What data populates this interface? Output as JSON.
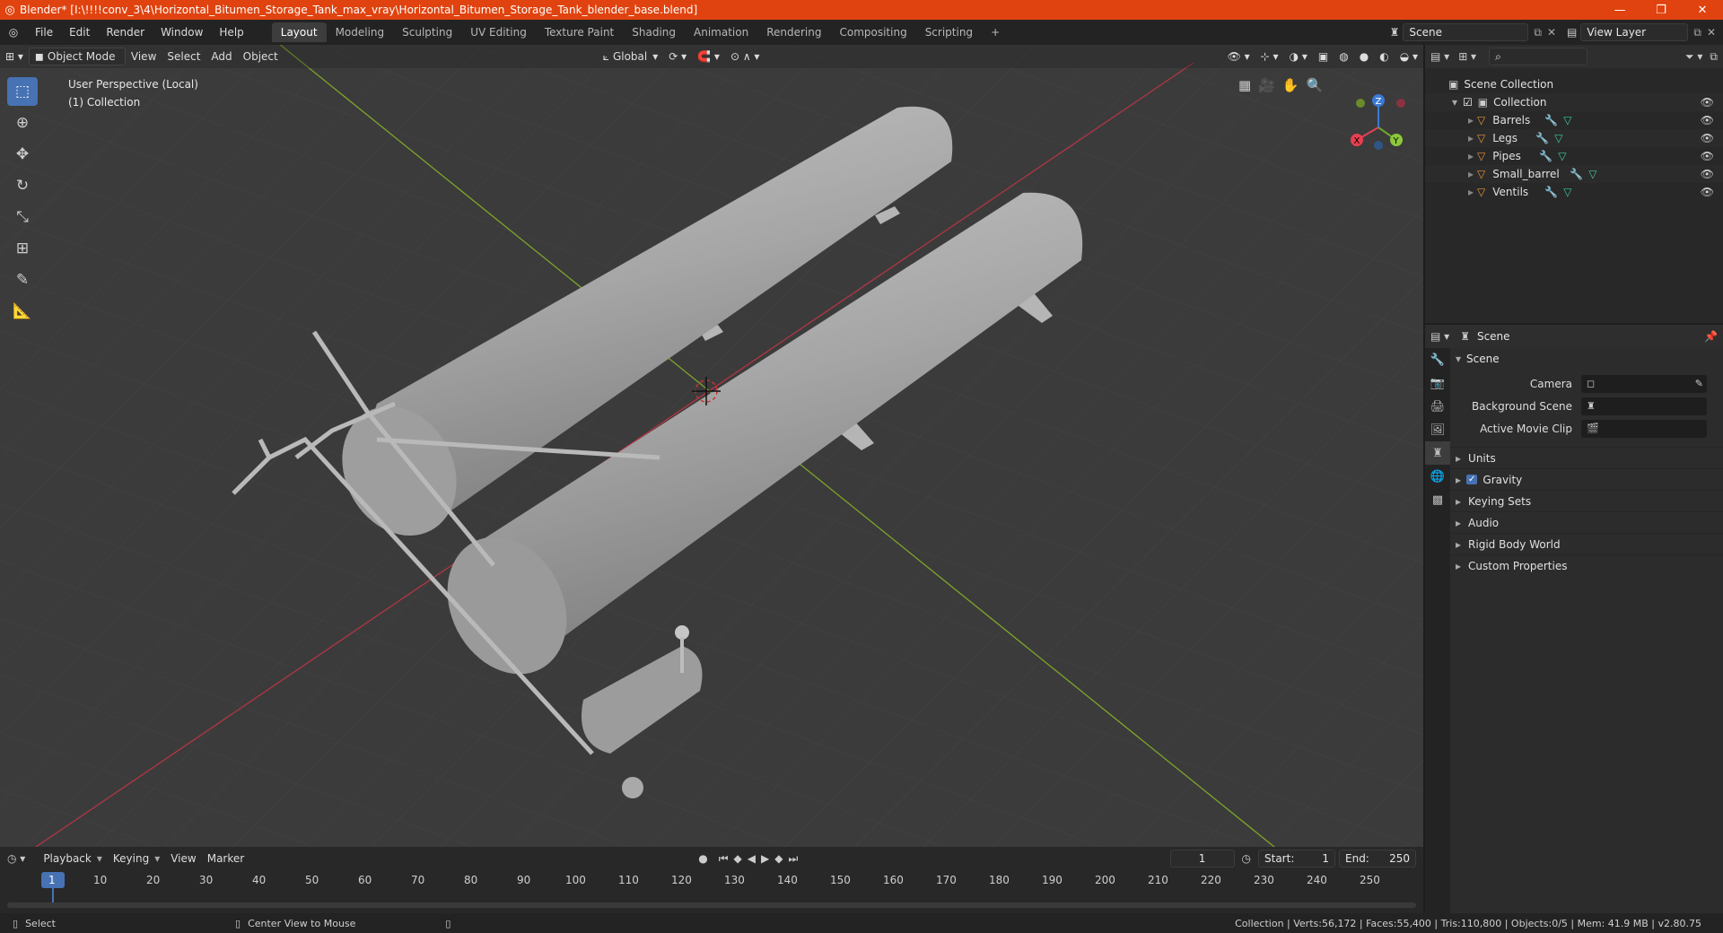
{
  "window": {
    "title": "Blender* [I:\\!!!!conv_3\\4\\Horizontal_Bitumen_Storage_Tank_max_vray\\Horizontal_Bitumen_Storage_Tank_blender_base.blend]",
    "controls": [
      "—",
      "❐",
      "✕"
    ]
  },
  "menubar": {
    "items": [
      "File",
      "Edit",
      "Render",
      "Window",
      "Help"
    ],
    "workspaces": [
      "Layout",
      "Modeling",
      "Sculpting",
      "UV Editing",
      "Texture Paint",
      "Shading",
      "Animation",
      "Rendering",
      "Compositing",
      "Scripting"
    ],
    "active_workspace": "Layout",
    "add_tab": "+",
    "scene": "Scene",
    "view_layer": "View Layer"
  },
  "viewport": {
    "mode": "Object Mode",
    "menus": [
      "View",
      "Select",
      "Add",
      "Object"
    ],
    "orientation": "Global",
    "info_line1": "User Perspective (Local)",
    "info_line2": "(1) Collection",
    "gizmo": {
      "x": "X",
      "y": "Y",
      "z": "Z"
    },
    "colors": {
      "bg": "#3b3b3b",
      "x_axis": "#b03645",
      "y_axis": "#7ea52a",
      "tank": "#a8a8a8",
      "accent": "#4772b3"
    }
  },
  "outliner": {
    "root": "Scene Collection",
    "collection": "Collection",
    "items": [
      "Barrels",
      "Legs",
      "Pipes",
      "Small_barrel",
      "Ventils"
    ]
  },
  "properties": {
    "header": "Scene",
    "panel": "Scene",
    "fields": [
      {
        "label": "Camera",
        "value": ""
      },
      {
        "label": "Background Scene",
        "value": ""
      },
      {
        "label": "Active Movie Clip",
        "value": ""
      }
    ],
    "subpanels": [
      "Units",
      "Gravity",
      "Keying Sets",
      "Audio",
      "Rigid Body World",
      "Custom Properties"
    ]
  },
  "timeline": {
    "menus": [
      "Playback",
      "Keying",
      "View",
      "Marker"
    ],
    "current_frame": "1",
    "start_label": "Start:",
    "start": "1",
    "end_label": "End:",
    "end": "250",
    "ticks": [
      "1",
      "10",
      "20",
      "30",
      "40",
      "50",
      "60",
      "70",
      "80",
      "90",
      "100",
      "110",
      "120",
      "130",
      "140",
      "150",
      "160",
      "170",
      "180",
      "190",
      "200",
      "210",
      "220",
      "230",
      "240",
      "250"
    ]
  },
  "statusbar": {
    "left_action": "Select",
    "mid_action": "Center View to Mouse",
    "stats": "Collection | Verts:56,172 | Faces:55,400 | Tris:110,800 | Objects:0/5 | Mem: 41.9 MB | v2.80.75"
  }
}
